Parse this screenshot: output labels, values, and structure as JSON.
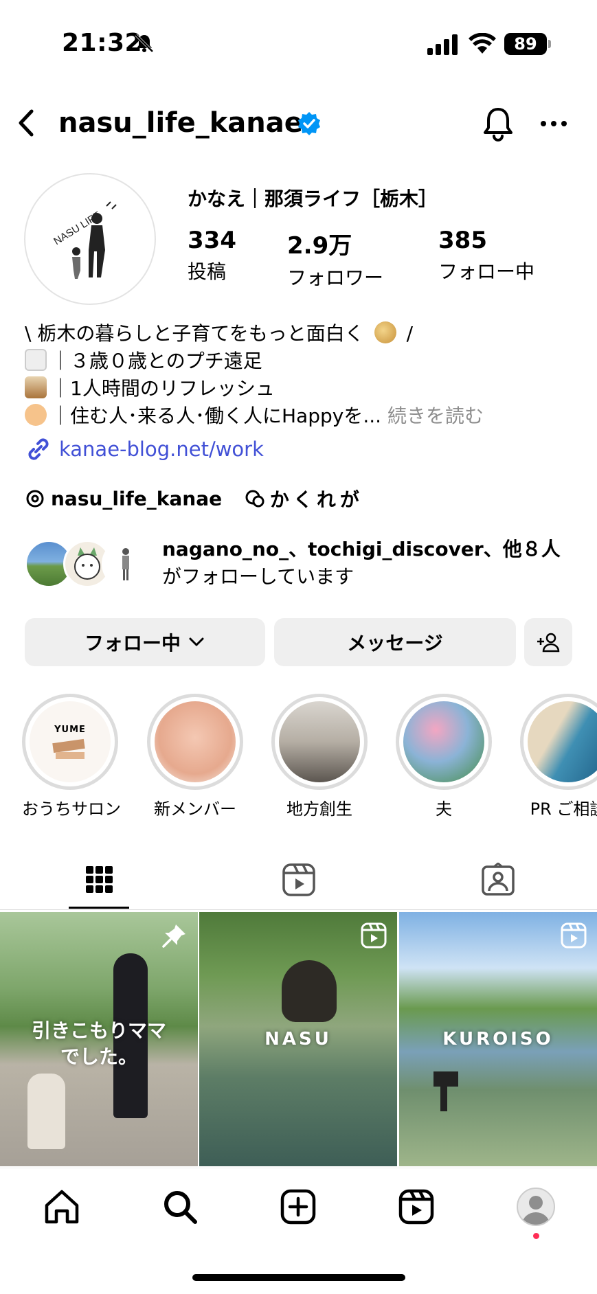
{
  "status_bar": {
    "time": "21:32",
    "battery": "89"
  },
  "header": {
    "username": "nasu_life_kanae"
  },
  "profile": {
    "display_name": "かなえ｜那須ライフ［栃木］",
    "avatar_text": "NASU LIFE",
    "stats": [
      {
        "value": "334",
        "label": "投稿"
      },
      {
        "value": "2.9万",
        "label": "フォロワー"
      },
      {
        "value": "385",
        "label": "フォロー中"
      }
    ],
    "bio": {
      "line1": "\\ 栃木の暮らしと子育てをもっと面白く",
      "line1_end": " /",
      "line2": "｜３歳０歳とのプチ遠足",
      "line3": "｜1人時間のリフレッシュ",
      "line4": "｜住む人･来る人･働く人にHappyを...",
      "more": " 続きを読む"
    },
    "link": "kanae-blog.net/work",
    "threads_handle": "nasu_life_kanae",
    "threads_extra": "かくれが",
    "followed_by_line1": "nagano_no_、tochigi_discover、他８人",
    "followed_by_line2": "がフォローしています"
  },
  "buttons": {
    "following": "フォロー中",
    "message": "メッセージ"
  },
  "highlights": [
    {
      "label": "おうちサロン",
      "inner_text": "YUME"
    },
    {
      "label": "新メンバー"
    },
    {
      "label": "地方創生"
    },
    {
      "label": "夫"
    },
    {
      "label": "PR ご相談"
    }
  ],
  "posts": [
    {
      "text": "引きこもりママ\nでした。",
      "icon": "pin-icon"
    },
    {
      "text": "NASU",
      "icon": "reel-icon"
    },
    {
      "text": "KUROISO",
      "icon": "reel-icon"
    }
  ],
  "colors": {
    "link": "#4150d6",
    "verified": "#0095f6",
    "button_bg": "#efefef",
    "notif": "#ff2d55"
  }
}
